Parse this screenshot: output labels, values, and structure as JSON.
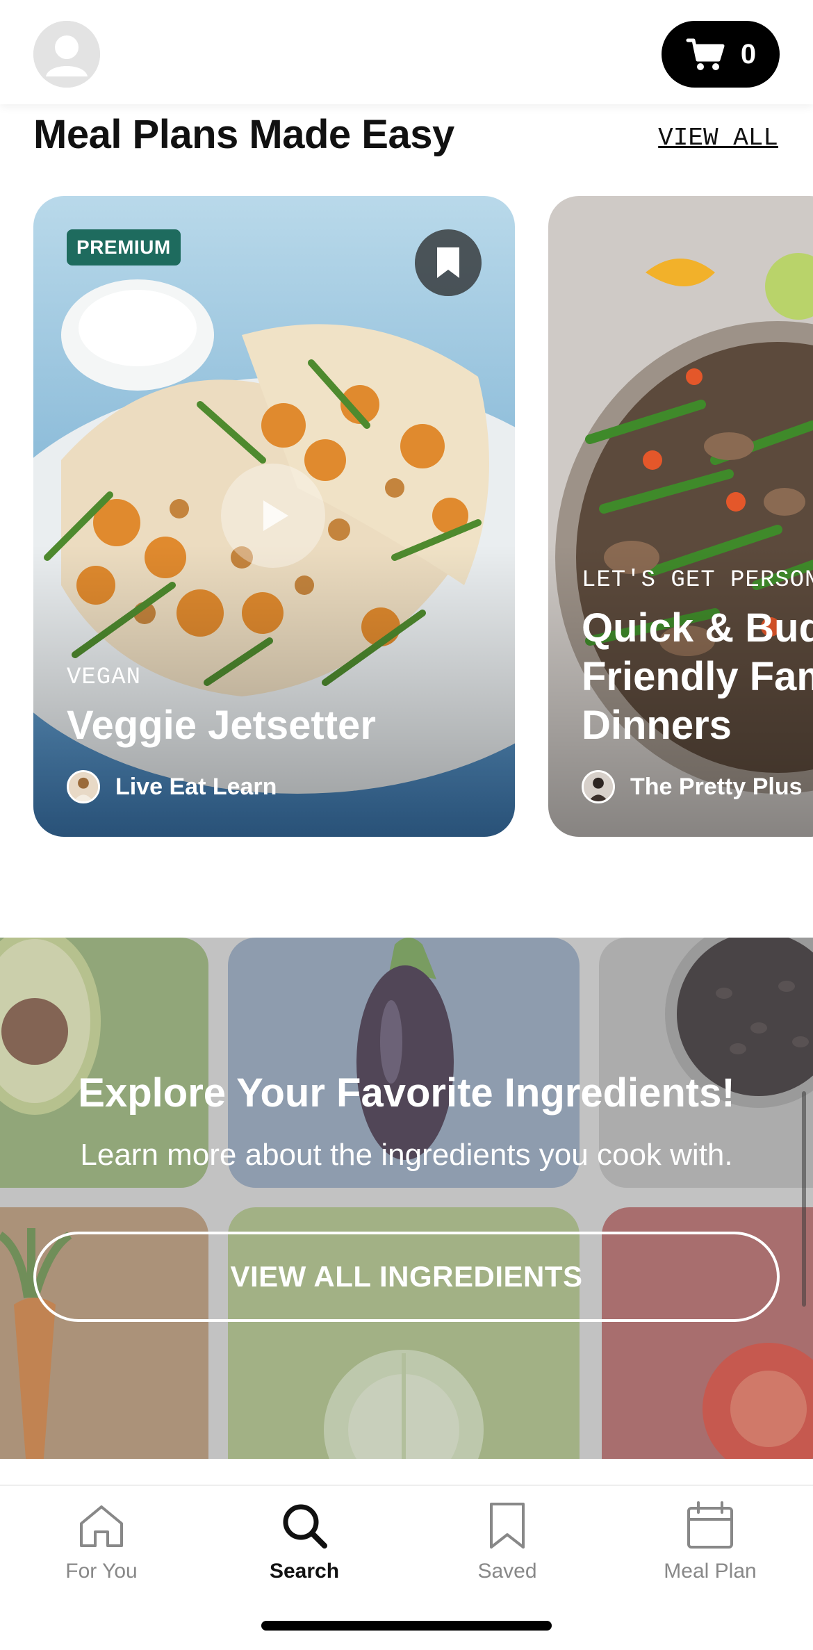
{
  "header": {
    "cart_count": "0",
    "icons": {
      "avatar": "user-avatar-icon",
      "cart": "cart-icon"
    }
  },
  "meal_plans": {
    "title": "Meal Plans Made Easy",
    "view_all": "VIEW ALL",
    "cards": [
      {
        "badge": "PREMIUM",
        "category": "VEGAN",
        "title": "Veggie Jetsetter",
        "author": "Live Eat Learn"
      },
      {
        "category": "LET'S GET PERSONAL",
        "title_line1": "Quick & Budget",
        "title_line2": "Friendly Family",
        "title_line3": "Dinners",
        "author": "The Pretty Plus"
      }
    ]
  },
  "ingredients": {
    "title": "Explore Your Favorite Ingredients!",
    "subtitle": "Learn more about the ingredients you cook with.",
    "button": "VIEW ALL INGREDIENTS"
  },
  "nav": {
    "items": [
      {
        "label": "For You",
        "icon": "home-icon"
      },
      {
        "label": "Search",
        "icon": "search-icon",
        "active": true
      },
      {
        "label": "Saved",
        "icon": "bookmark-icon"
      },
      {
        "label": "Meal Plan",
        "icon": "calendar-icon"
      }
    ]
  },
  "colors": {
    "premium_badge": "#1e6b5e",
    "cart_bg": "#000000",
    "nav_inactive": "#888888"
  }
}
